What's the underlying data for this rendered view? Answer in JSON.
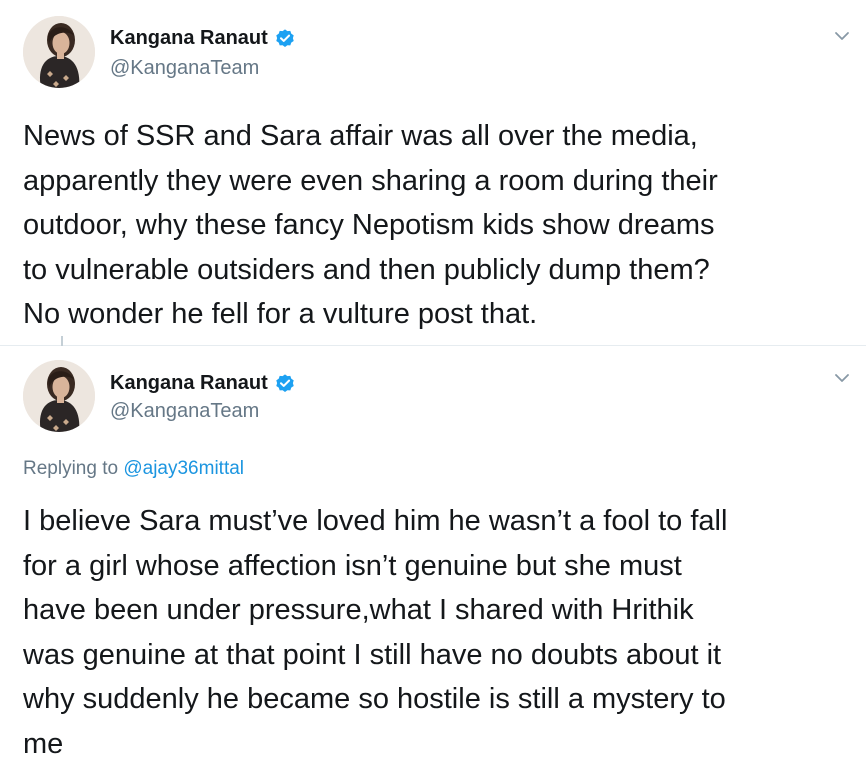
{
  "tweets": [
    {
      "author": {
        "name": "Kangana Ranaut",
        "handle": "@KanganaTeam",
        "verified": true
      },
      "text_lines": [
        "News of SSR and Sara affair was all over the media,",
        "apparently they were even sharing a room during their",
        "outdoor, why these fancy Nepotism kids show dreams",
        "to vulnerable outsiders and then publicly dump them?",
        "No wonder he fell for a vulture post that."
      ]
    },
    {
      "author": {
        "name": "Kangana Ranaut",
        "handle": "@KanganaTeam",
        "verified": true
      },
      "replying_label": "Replying to",
      "replying_to": "@ajay36mittal",
      "text_lines": [
        "I believe Sara must’ve loved him he wasn’t a fool to fall",
        "for a girl whose affection isn’t genuine but she must",
        "have been under pressure,what I shared with Hrithik",
        "was genuine at that point I still have no doubts about it",
        "why suddenly he became so hostile is still a mystery to",
        "me"
      ]
    }
  ],
  "colors": {
    "verified_badge": "#1da1f2",
    "link": "#1b95e0",
    "secondary_text": "#657786",
    "primary_text": "#14171a",
    "caret": "#8899a6"
  },
  "icons": {
    "verified": "verified-badge-icon",
    "menu": "chevron-down-icon"
  }
}
